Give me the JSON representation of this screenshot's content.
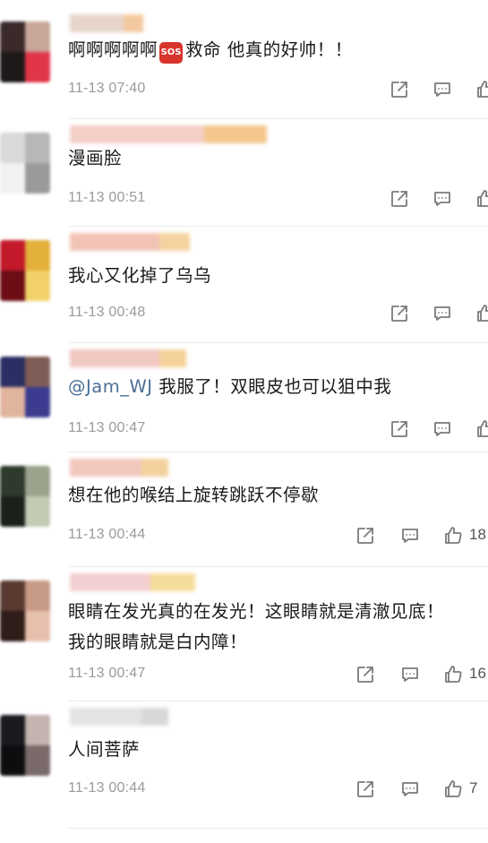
{
  "comments": [
    {
      "text_lines": [
        "啊啊啊啊啊",
        "救命 他真的好帅！！"
      ],
      "badge": "SOS",
      "timestamp": "11-13 07:40",
      "avatar_colors": [
        "#3a2a2a",
        "#c8a79a",
        "#1f1818",
        "#e1364a"
      ],
      "username_colors": [
        "#e7d5ca",
        "#f3c9a0"
      ]
    },
    {
      "text_lines": [
        "漫画脸"
      ],
      "timestamp": "11-13 00:51",
      "avatar_colors": [
        "#d9d9d9",
        "#b7b7b7",
        "#f1f1f1",
        "#9a9a9a"
      ],
      "username_colors": [
        "#f3cfc6",
        "#f4c78c"
      ]
    },
    {
      "text_lines": [
        "我心又化掉了乌乌"
      ],
      "timestamp": "11-13 00:48",
      "avatar_colors": [
        "#c2192b",
        "#e3b03a",
        "#6d0d15",
        "#f2d16a"
      ],
      "username_colors": [
        "#f2c3b6",
        "#f5d3a0"
      ]
    },
    {
      "mention": "@Jam_WJ",
      "text_lines": [
        "我服了！双眼皮也可以狙中我"
      ],
      "timestamp": "11-13 00:47",
      "avatar_colors": [
        "#2b2e63",
        "#7f5c55",
        "#e0b49d",
        "#3c3b8f"
      ],
      "username_colors": [
        "#f1c8c2",
        "#f5d29a"
      ]
    },
    {
      "text_lines": [
        "想在他的喉结上旋转跳跃不停歇"
      ],
      "timestamp": "11-13 00:44",
      "like_count": "18",
      "avatar_colors": [
        "#2e3a2c",
        "#9aa38c",
        "#1b201a",
        "#c3cbb4"
      ],
      "username_colors": [
        "#f1c7be",
        "#f4d19e"
      ]
    },
    {
      "text_lines": [
        "眼睛在发光真的在发光！这眼睛就是清澈见底！",
        "我的眼睛就是白内障！"
      ],
      "timestamp": "11-13 00:47",
      "like_count": "16",
      "avatar_colors": [
        "#5a3a30",
        "#c79a86",
        "#2e1d18",
        "#e6c0ad"
      ],
      "username_colors": [
        "#f4cfd1",
        "#f6dc9a"
      ]
    },
    {
      "text_lines": [
        "人间菩萨"
      ],
      "timestamp": "11-13 00:44",
      "like_count": "7",
      "avatar_colors": [
        "#1a1a1f",
        "#c4b3b0",
        "#0d0d10",
        "#7a6a6a"
      ],
      "username_colors": [
        "#e3e3e3",
        "#d8d8d8"
      ]
    }
  ],
  "icons": {
    "share": "share-icon",
    "reply": "comment-icon",
    "like": "thumbs-up-icon"
  },
  "colors": {
    "text": "#1a1a1a",
    "timestamp": "#9a9a9a",
    "mention": "#4a6f95",
    "icon": "#7a7a7a",
    "badge_bg": "#d9342b"
  }
}
